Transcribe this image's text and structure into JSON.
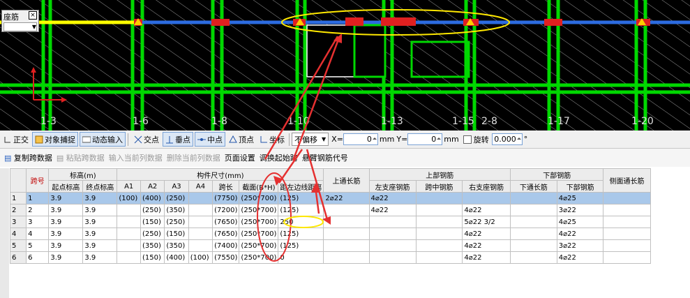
{
  "cad": {
    "layer_name": "座筋",
    "layer_close": "×",
    "axis_labels": [
      "1-3",
      "1-6",
      "1-8",
      "1-10",
      "1-13",
      "1-15",
      "2-8",
      "1-17",
      "1-20"
    ],
    "colors": {
      "beam_blue": "#2c6be0",
      "beam_yellow": "#ffff00",
      "grid_green": "#00e000",
      "hatch": "#c8c8c8"
    }
  },
  "snap_toolbar": {
    "orthogonal": "正交",
    "object_snap": "对象捕捉",
    "dynamic_input": "动态输入",
    "intersection": "交点",
    "perpendicular": "垂点",
    "midpoint": "中点",
    "vertex": "顶点",
    "coordinate": "坐标",
    "offset_mode": "不偏移",
    "x_label": "X=",
    "x_value": "0",
    "y_label": "Y=",
    "y_value": "0",
    "unit_mm1": "mm",
    "unit_mm2": "mm",
    "rotate_label": "旋转",
    "rotate_value": "0.000",
    "degree": "°"
  },
  "grid_toolbar": {
    "copy_span": "复制跨数据",
    "paste_span": "粘贴跨数据",
    "input_column": "输入当前列数据",
    "delete_column": "删除当前列数据",
    "page_setup": "页面设置",
    "swap_start": "调换起始跨",
    "cantilever": "悬臂钢筋代号"
  },
  "table": {
    "header_top": {
      "span_no": "跨号",
      "elevation": "标高(m)",
      "dimensions": "构件尺寸(mm)",
      "top_through": "上通长筋",
      "top_rebar": "上部钢筋",
      "bottom_rebar": "下部钢筋",
      "side_through": "侧面通长筋"
    },
    "header_sub": [
      "起点标高",
      "终点标高",
      "A1",
      "A2",
      "A3",
      "A4",
      "跨长",
      "截面(B*H)",
      "距左边线距离",
      "左支座钢筋",
      "跨中钢筋",
      "右支座钢筋",
      "下通长筋",
      "下部钢筋"
    ],
    "rows": [
      {
        "rn": "1",
        "span": "1",
        "start": "3.9",
        "end": "3.9",
        "a1": "(100)",
        "a2": "(400)",
        "a3": "(250)",
        "a4": "",
        "len": "(7750)",
        "sec": "(250*700)",
        "dist": "(125)",
        "topthrough": "2⌀22",
        "left": "4⌀22",
        "mid": "",
        "right": "",
        "botthrough": "",
        "bottom": "4⌀25",
        "side": ""
      },
      {
        "rn": "2",
        "span": "2",
        "start": "3.9",
        "end": "3.9",
        "a1": "",
        "a2": "(250)",
        "a3": "(350)",
        "a4": "",
        "len": "(7200)",
        "sec": "(250*700)",
        "dist": "(125)",
        "topthrough": "",
        "left": "4⌀22",
        "mid": "",
        "right": "4⌀22",
        "botthrough": "",
        "bottom": "3⌀22",
        "side": ""
      },
      {
        "rn": "3",
        "span": "3",
        "start": "3.9",
        "end": "3.9",
        "a1": "",
        "a2": "(150)",
        "a3": "(250)",
        "a4": "",
        "len": "(7650)",
        "sec": "(250*700)",
        "dist": "250",
        "topthrough": "",
        "left": "",
        "mid": "",
        "right": "5⌀22 3/2",
        "botthrough": "",
        "bottom": "4⌀25",
        "side": ""
      },
      {
        "rn": "4",
        "span": "4",
        "start": "3.9",
        "end": "3.9",
        "a1": "",
        "a2": "(250)",
        "a3": "(150)",
        "a4": "",
        "len": "(7650)",
        "sec": "(250*700)",
        "dist": "(125)",
        "topthrough": "",
        "left": "",
        "mid": "",
        "right": "4⌀22",
        "botthrough": "",
        "bottom": "4⌀22",
        "side": ""
      },
      {
        "rn": "5",
        "span": "5",
        "start": "3.9",
        "end": "3.9",
        "a1": "",
        "a2": "(350)",
        "a3": "(350)",
        "a4": "",
        "len": "(7400)",
        "sec": "(250*700)",
        "dist": "(125)",
        "topthrough": "",
        "left": "",
        "mid": "",
        "right": "4⌀22",
        "botthrough": "",
        "bottom": "3⌀22",
        "side": ""
      },
      {
        "rn": "6",
        "span": "6",
        "start": "3.9",
        "end": "3.9",
        "a1": "",
        "a2": "(150)",
        "a3": "(400)",
        "a4": "(100)",
        "len": "(7550)",
        "sec": "(250*700)",
        "dist": "0",
        "topthrough": "",
        "left": "",
        "mid": "",
        "right": "4⌀22",
        "botthrough": "",
        "bottom": "4⌀22",
        "side": ""
      }
    ]
  }
}
